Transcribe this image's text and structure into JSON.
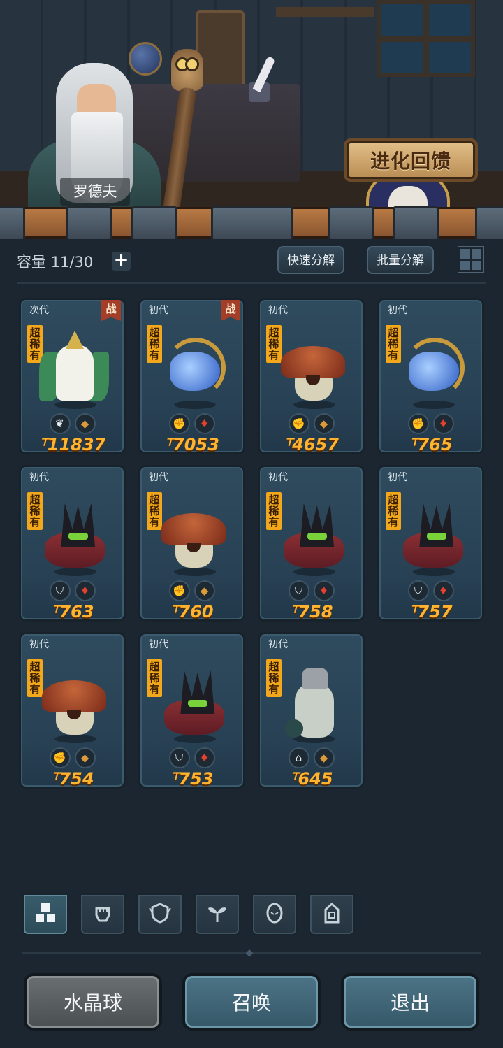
{
  "npc": {
    "name": "罗德夫"
  },
  "event_button": {
    "label": "进化回馈"
  },
  "inventory": {
    "capacity_label": "容量 11/30",
    "add_icon": "plus-icon",
    "quick_decompose": "快速分解",
    "batch_decompose": "批量分解",
    "layout_icon": "grid-view-icon"
  },
  "cards": [
    {
      "gen": "次代",
      "battle": "战",
      "rarity": "超稀有",
      "monster": "angel",
      "badges": [
        "leaf",
        "rock"
      ],
      "power": "11837"
    },
    {
      "gen": "初代",
      "battle": "战",
      "rarity": "超稀有",
      "monster": "spirit",
      "badges": [
        "fist",
        "fire"
      ],
      "power": "7053"
    },
    {
      "gen": "初代",
      "battle": "",
      "rarity": "超稀有",
      "monster": "mush",
      "badges": [
        "fist",
        "rock"
      ],
      "power": "4657"
    },
    {
      "gen": "初代",
      "battle": "",
      "rarity": "超稀有",
      "monster": "spirit",
      "badges": [
        "fist",
        "fire"
      ],
      "power": "765"
    },
    {
      "gen": "初代",
      "battle": "",
      "rarity": "超稀有",
      "monster": "beast",
      "badges": [
        "shield",
        "fire"
      ],
      "power": "763"
    },
    {
      "gen": "初代",
      "battle": "",
      "rarity": "超稀有",
      "monster": "mush",
      "badges": [
        "fist",
        "rock"
      ],
      "power": "760"
    },
    {
      "gen": "初代",
      "battle": "",
      "rarity": "超稀有",
      "monster": "beast",
      "badges": [
        "shield",
        "fire"
      ],
      "power": "758"
    },
    {
      "gen": "初代",
      "battle": "",
      "rarity": "超稀有",
      "monster": "beast",
      "badges": [
        "shield",
        "fire"
      ],
      "power": "757"
    },
    {
      "gen": "初代",
      "battle": "",
      "rarity": "超稀有",
      "monster": "mush",
      "badges": [
        "fist",
        "rock"
      ],
      "power": "754"
    },
    {
      "gen": "初代",
      "battle": "",
      "rarity": "超稀有",
      "monster": "beast",
      "badges": [
        "shield",
        "fire"
      ],
      "power": "753"
    },
    {
      "gen": "初代",
      "battle": "",
      "rarity": "超稀有",
      "monster": "knight",
      "badges": [
        "tower",
        "rock"
      ],
      "power": "645"
    }
  ],
  "filter_tabs": [
    {
      "icon": "all-blocks-icon",
      "active": true
    },
    {
      "icon": "fist-icon",
      "active": false
    },
    {
      "icon": "shield-icon",
      "active": false
    },
    {
      "icon": "leaf-icon",
      "active": false
    },
    {
      "icon": "spirit-icon",
      "active": false
    },
    {
      "icon": "tower-icon",
      "active": false
    }
  ],
  "bottom_buttons": {
    "crystal_ball": "水晶球",
    "summon": "召唤",
    "exit": "退出"
  },
  "colors": {
    "background": "#1b2630",
    "power_text": "#ffb32e",
    "rarity_tag": "#f2a81a",
    "battle_tag": "#a33e28",
    "card_bg": "#2f4b5e"
  }
}
